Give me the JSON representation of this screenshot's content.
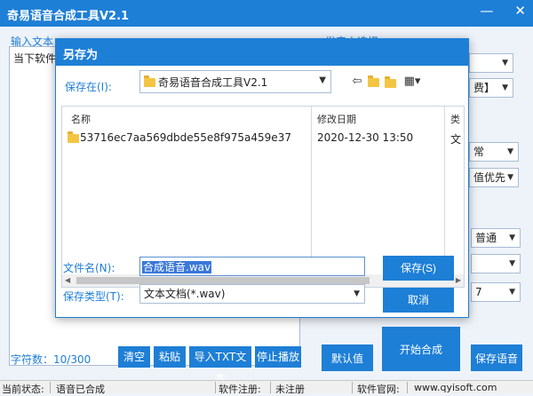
{
  "app": {
    "title": "奇易语音合成工具V2.1"
  },
  "main": {
    "input_label": "输入文本",
    "text_content": "当下软件园",
    "char_count": "字符数：10/300",
    "buttons": {
      "clear": "清空",
      "paste": "粘贴",
      "import": "导入TXT文本",
      "stop": "停止播放"
    }
  },
  "right_panel": {
    "label": "发音人选择",
    "selects": {
      "free": "费】",
      "normal": "常",
      "priority": "值优先",
      "speed": "普通",
      "volume": "7"
    },
    "buttons": {
      "default": "默认值",
      "start": "开始合成",
      "save": "保存语音"
    }
  },
  "dialog": {
    "title": "另存为",
    "save_in_label": "保存在(I):",
    "save_in_value": "奇易语音合成工具V2.1",
    "columns": {
      "name": "名称",
      "date": "修改日期",
      "type": "类"
    },
    "files": [
      {
        "name": "53716ec7aa569dbde55e8f975a459e37",
        "date": "2020-12-30 13:50",
        "type": "文"
      }
    ],
    "filename_label": "文件名(N):",
    "filename_value": "合成语音.wav",
    "filetype_label": "保存类型(T):",
    "filetype_value": "文本文档(*.wav)",
    "save_button": "保存(S)",
    "cancel_button": "取消"
  },
  "statusbar": {
    "status_label": "当前状态:",
    "status_value": "语音已合成",
    "reg_label": "软件注册:",
    "reg_value": "未注册",
    "site_label": "软件官网:",
    "site_value": "www.qyisoft.com"
  },
  "watermark": "当下软件园"
}
